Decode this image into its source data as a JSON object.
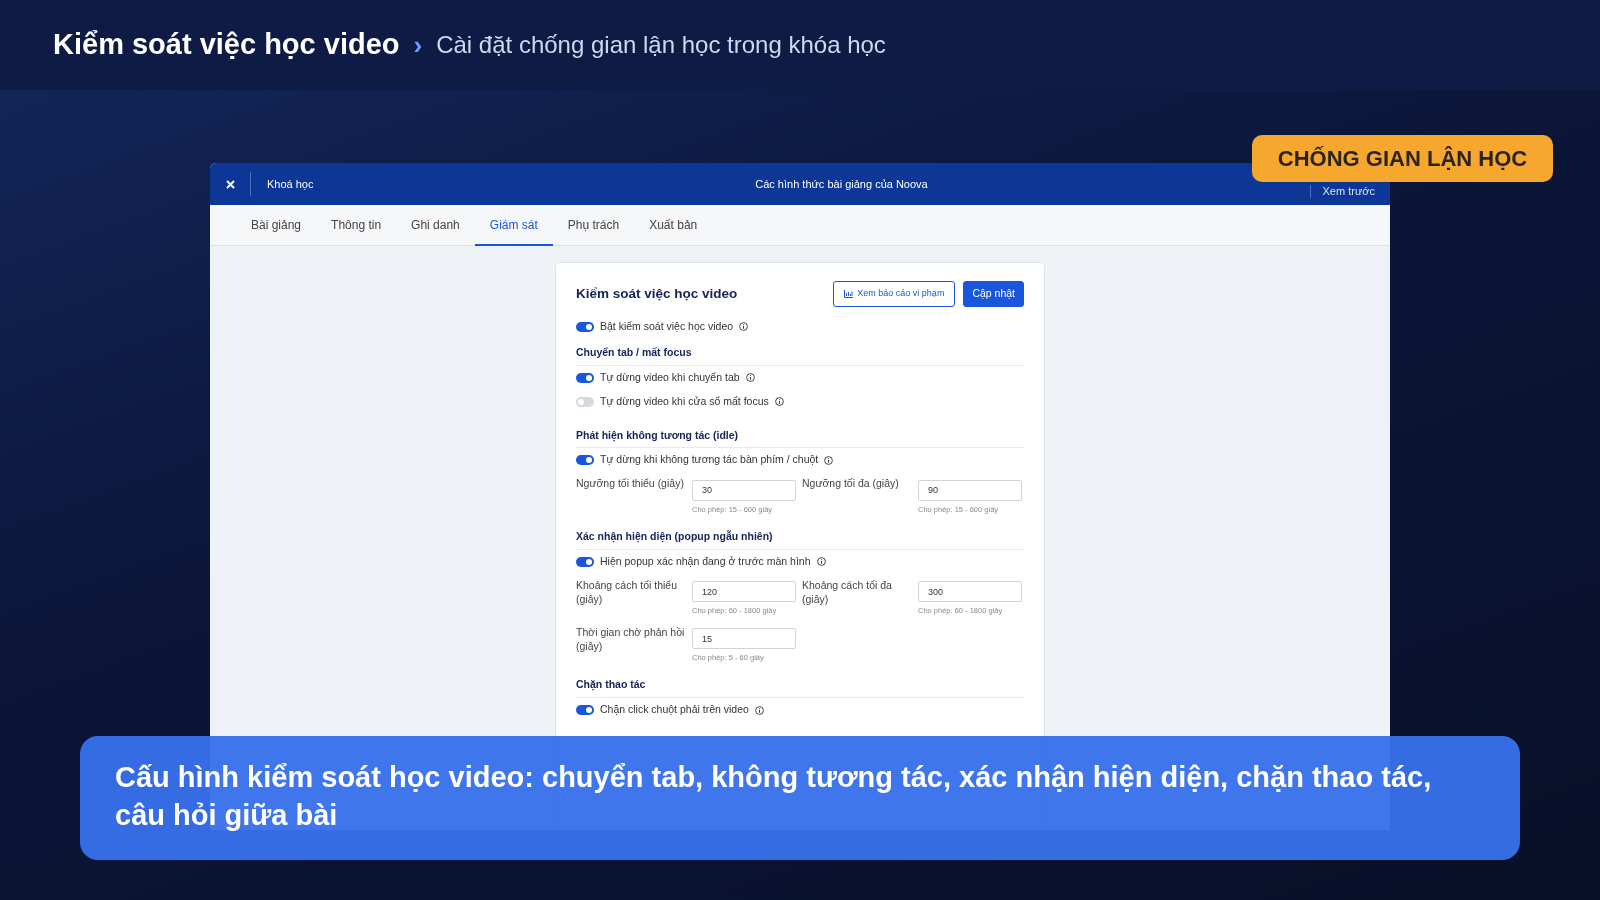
{
  "header": {
    "title": "Kiểm soát việc học video",
    "separator": "›",
    "subtitle": "Cài đặt chống gian lận học trong khóa học"
  },
  "badge": "CHỐNG GIAN LẬN HỌC",
  "window": {
    "back_label": "Khoá học",
    "title": "Các hình thức bài giảng của Noova",
    "preview": "Xem trước"
  },
  "tabs": [
    {
      "label": "Bài giảng",
      "selected": false
    },
    {
      "label": "Thông tin",
      "selected": false
    },
    {
      "label": "Ghi danh",
      "selected": false
    },
    {
      "label": "Giám sát",
      "selected": true
    },
    {
      "label": "Phụ trách",
      "selected": false
    },
    {
      "label": "Xuất bản",
      "selected": false
    }
  ],
  "panel": {
    "title": "Kiểm soát việc học video",
    "report_button": "Xem báo cáo vi phạm",
    "update_button": "Cập nhật",
    "sections": [
      {
        "items": [
          {
            "kind": "toggle",
            "label": "Bật kiểm soát việc học video",
            "on": true
          }
        ]
      },
      {
        "heading": "Chuyển tab / mất focus",
        "items": [
          {
            "kind": "toggle",
            "label": "Tự dừng video khi chuyển tab",
            "on": true
          },
          {
            "kind": "toggle",
            "label": "Tự dừng video khi cửa sổ mất focus",
            "on": false
          }
        ]
      },
      {
        "heading": "Phát hiện không tương tác (idle)",
        "items": [
          {
            "kind": "toggle",
            "label": "Tự dừng khi không tương tác bàn phím / chuột",
            "on": true
          },
          {
            "kind": "fields",
            "fields": [
              {
                "label": "Ngưỡng tối thiểu (giây)",
                "value": "30",
                "hint": "Cho phép: 15 - 600 giây"
              },
              {
                "label": "Ngưỡng tối đa (giây)",
                "value": "90",
                "hint": "Cho phép: 15 - 600 giây"
              }
            ]
          }
        ]
      },
      {
        "heading": "Xác nhận hiện diện (popup ngẫu nhiên)",
        "items": [
          {
            "kind": "toggle",
            "label": "Hiện popup xác nhận đang ở trước màn hình",
            "on": true
          },
          {
            "kind": "fields",
            "fields": [
              {
                "label": "Khoảng cách tối thiểu (giây)",
                "value": "120",
                "hint": "Cho phép: 60 - 1800 giây"
              },
              {
                "label": "Khoảng cách tối đa (giây)",
                "value": "300",
                "hint": "Cho phép: 60 - 1800 giây"
              }
            ]
          },
          {
            "kind": "fields",
            "fields": [
              {
                "label": "Thời gian chờ phản hồi (giây)",
                "value": "15",
                "hint": "Cho phép: 5 - 60 giây"
              }
            ]
          }
        ]
      },
      {
        "heading": "Chặn thao tác",
        "items": [
          {
            "kind": "toggle",
            "label": "Chặn click chuột phải trên video",
            "on": true
          }
        ]
      }
    ]
  },
  "caption": "Cấu hình kiểm soát học video: chuyển tab, không tương tác, xác nhận hiện diện, chặn thao tác, câu hỏi giữa bài"
}
